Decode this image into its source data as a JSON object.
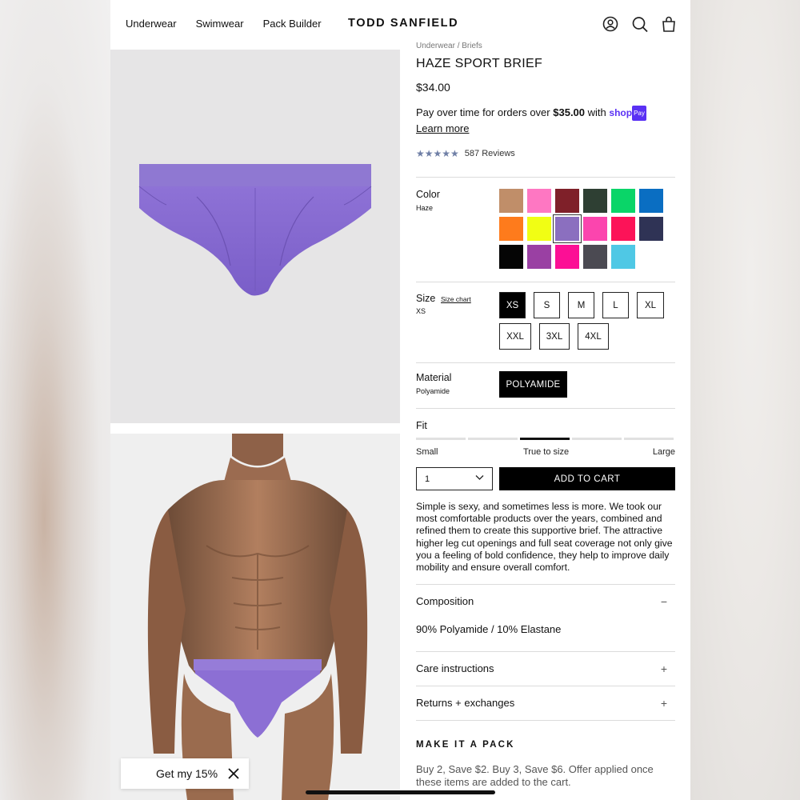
{
  "header": {
    "nav": [
      "Underwear",
      "Swimwear",
      "Pack Builder"
    ],
    "logo": "TODD SANFIELD",
    "icons": [
      "account-icon",
      "search-icon",
      "cart-icon"
    ]
  },
  "promo": {
    "label": "Get my 15%"
  },
  "product": {
    "breadcrumb": "Underwear / Briefs",
    "title": "HAZE SPORT BRIEF",
    "price": "$34.00",
    "shoppay": {
      "text": "Pay over time for orders over",
      "amount": "$35.00",
      "with": "with",
      "brand": "shop",
      "brand_badge": "Pay",
      "learn_more": "Learn more"
    },
    "rating": {
      "stars": "★★★★★",
      "reviews": "587 Reviews"
    },
    "color": {
      "label": "Color",
      "selected": "Haze",
      "swatches": [
        "#c08e69",
        "#fe77c2",
        "#7f2029",
        "#2e3f33",
        "#0ad568",
        "#0a6ec2",
        "#fe7b1c",
        "#f1fe14",
        "#8b6fbf",
        "#fb45ae",
        "#fc1358",
        "#2f3355",
        "#050505",
        "#9a40a3",
        "#fc0f95",
        "#4b4a52",
        "#4fc8e5"
      ],
      "selected_index": 8
    },
    "size": {
      "label": "Size",
      "size_chart": "Size chart",
      "selected": "XS",
      "options": [
        "XS",
        "S",
        "M",
        "L",
        "XL",
        "XXL",
        "3XL",
        "4XL"
      ]
    },
    "material": {
      "label": "Material",
      "selected": "Polyamide",
      "option": "POLYAMIDE"
    },
    "fit": {
      "label": "Fit",
      "low": "Small",
      "mid": "True to size",
      "high": "Large",
      "selected_index": 2
    },
    "quantity": "1",
    "add_to_cart": "ADD TO CART",
    "description": "Simple is sexy, and sometimes less is more. We took our most comfortable products over the years, combined and refined them to create this supportive brief. The attractive higher leg cut openings and full seat coverage not only give you a feeling of bold confidence, they help to improve daily mobility and ensure overall comfort.",
    "accordions": {
      "composition": {
        "label": "Composition",
        "sign": "−",
        "content": "90% Polyamide / 10% Elastane"
      },
      "care": {
        "label": "Care instructions",
        "sign": "+"
      },
      "returns": {
        "label": "Returns + exchanges",
        "sign": "+"
      }
    },
    "pack": {
      "title": "MAKE IT A PACK",
      "text": "Buy 2, Save $2. Buy 3, Save $6. Offer applied once these items are added to the cart."
    }
  }
}
